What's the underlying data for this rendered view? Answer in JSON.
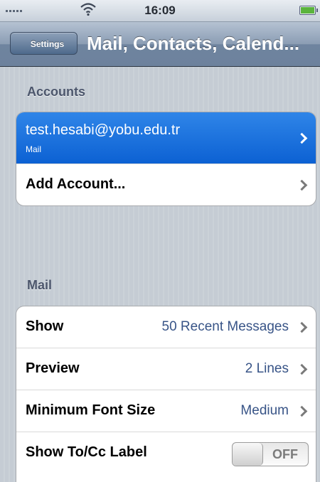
{
  "status_bar": {
    "time": "16:09"
  },
  "nav": {
    "back_label": "Settings",
    "title": "Mail, Contacts, Calend..."
  },
  "accounts": {
    "header": "Accounts",
    "items": [
      {
        "label": "test.hesabi@yobu.edu.tr",
        "sublabel": "Mail"
      },
      {
        "label": "Add Account..."
      }
    ]
  },
  "mail": {
    "header": "Mail",
    "items": [
      {
        "label": "Show",
        "value": "50 Recent Messages"
      },
      {
        "label": "Preview",
        "value": "2 Lines"
      },
      {
        "label": "Minimum Font Size",
        "value": "Medium"
      },
      {
        "label": "Show To/Cc Label",
        "toggle_label": "OFF"
      }
    ]
  },
  "icons": [
    "wifi-icon",
    "signal-icon",
    "battery-icon",
    "chevron-right-icon"
  ],
  "colors": {
    "selected_row": "#1a73df",
    "value_text": "#385487",
    "battery_fill": "#5ab43c"
  }
}
